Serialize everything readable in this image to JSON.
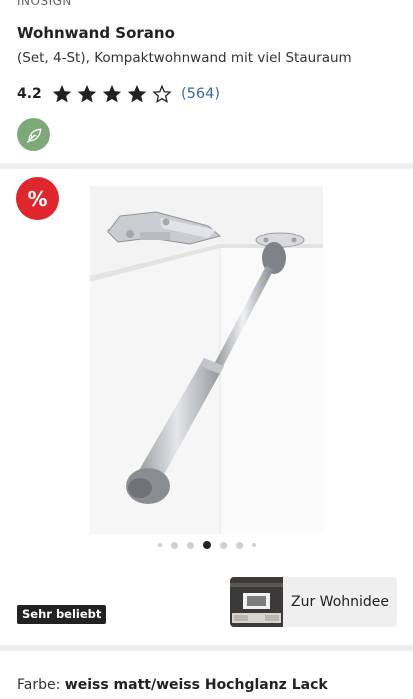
{
  "product": {
    "brand": "INOSIGN",
    "title": "Wohnwand Sorano",
    "subtitle": "(Set, 4-St), Kompaktwohnwand mit viel Stauraum",
    "rating": {
      "value": "4.2",
      "stars_filled": 4,
      "stars_total": 5,
      "review_count": "(564)"
    }
  },
  "icons": {
    "eco": "leaf-icon",
    "sale": "percent-icon",
    "star": "star-icon"
  },
  "sale_badge": {
    "label": "%"
  },
  "gallery": {
    "image_description": "Gasdruckfeder mit Scharnier",
    "dots_count": 7,
    "active_dot": 4
  },
  "badges": {
    "popular": "Sehr beliebt"
  },
  "idea_button": {
    "label": "Zur Wohnidee"
  },
  "color": {
    "label": "Farbe:",
    "value": "weiss matt/weiss Hochglanz Lack"
  },
  "colors": {
    "accent_red": "#e0262d",
    "link_blue": "#3a6aa8",
    "eco_green": "#7fa87a"
  }
}
